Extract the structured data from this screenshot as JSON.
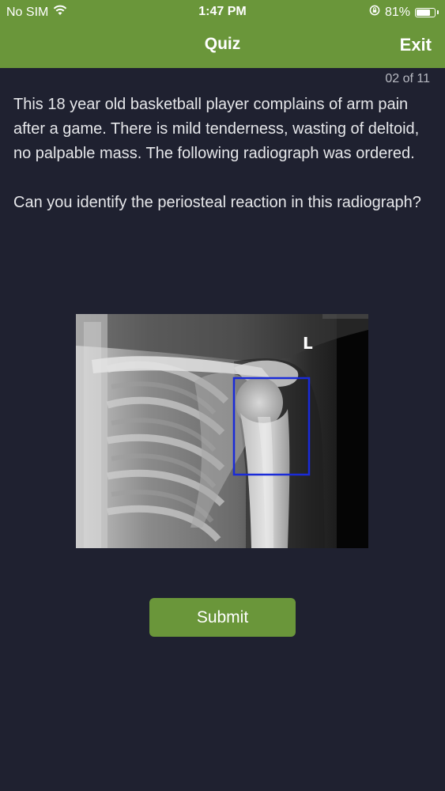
{
  "status_bar": {
    "carrier": "No SIM",
    "time": "1:47 PM",
    "battery_percent": "81%",
    "battery_level": 0.81,
    "icons": [
      "wifi-icon",
      "orientation-lock-icon",
      "battery-icon"
    ]
  },
  "header": {
    "title": "Quiz",
    "exit_label": "Exit",
    "background_color": "#6a963a"
  },
  "quiz": {
    "progress": "02 of 11",
    "question_text": "This 18 year old basketball player complains of arm pain after a game. There is mild tenderness, wasting of deltoid, no palpable mass. The following radiograph was ordered.",
    "prompt_text": "Can you identify the periosteal reaction in this radiograph?",
    "image_marker": "L",
    "highlight_color": "#1a2bd8",
    "submit_label": "Submit"
  },
  "colors": {
    "background": "#1f2130",
    "accent": "#6a963a",
    "text": "#e6e7ea"
  }
}
